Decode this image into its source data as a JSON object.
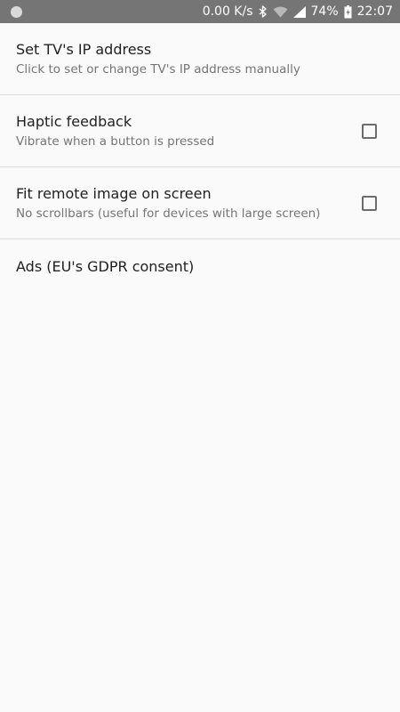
{
  "status_bar": {
    "net_speed": "0.00 K/s",
    "battery": "74%",
    "time": "22:07",
    "icons": [
      "notification-dot-icon",
      "bluetooth-icon",
      "wifi-icon",
      "signal-icon",
      "battery-icon"
    ]
  },
  "preferences": [
    {
      "title": "Set TV's IP address",
      "summary": "Click to set or change TV's IP address manually"
    },
    {
      "title": "Haptic feedback",
      "summary": "Vibrate when a button is pressed",
      "checked": false
    },
    {
      "title": "Fit remote image on screen",
      "summary": "No scrollbars (useful for devices with large screen)",
      "checked": false
    },
    {
      "title": "Ads (EU's GDPR consent)"
    }
  ]
}
